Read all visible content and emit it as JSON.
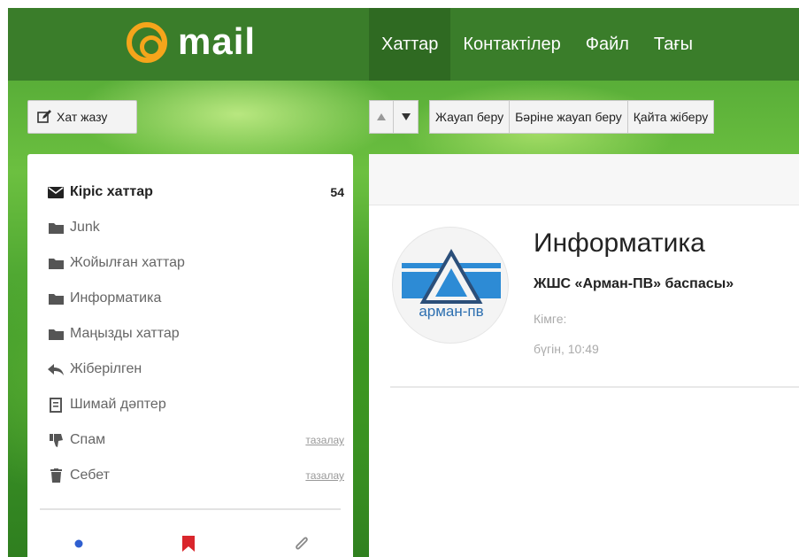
{
  "logo": {
    "text": "mail",
    "at_color": "#f5a51b"
  },
  "topnav": [
    {
      "label": "Хаттар",
      "active": true
    },
    {
      "label": "Контактілер",
      "active": false
    },
    {
      "label": "Файл",
      "active": false
    },
    {
      "label": "Тағы",
      "active": false
    }
  ],
  "toolbar": {
    "compose_label": "Хат жазу",
    "compose_icon": "pencil-edit-icon",
    "prev_icon": "arrow-up-icon",
    "next_icon": "arrow-down-icon",
    "actions": [
      "Жауап беру",
      "Бәріне жауап беру",
      "Қайта жіберу"
    ]
  },
  "sidebar": {
    "folders": [
      {
        "label": "Кіріс хаттар",
        "icon": "envelope-icon",
        "count": "54",
        "active": true
      },
      {
        "label": "Junk",
        "icon": "folder-icon"
      },
      {
        "label": "Жойылған хаттар",
        "icon": "folder-icon"
      },
      {
        "label": "Информатика",
        "icon": "folder-icon"
      },
      {
        "label": "Маңызды хаттар",
        "icon": "folder-icon"
      },
      {
        "label": "Жіберілген",
        "icon": "reply-arrow-icon"
      },
      {
        "label": "Шимай дәптер",
        "icon": "draft-note-icon"
      },
      {
        "label": "Спам",
        "icon": "thumbs-down-icon",
        "action": "тазалау"
      },
      {
        "label": "Себет",
        "icon": "trash-icon",
        "action": "тазалау"
      }
    ],
    "bottom_icons": [
      "unread-dot-icon",
      "flag-bookmark-icon",
      "attachment-clip-icon"
    ]
  },
  "message": {
    "subject": "Информатика",
    "sender": "ЖШС «Арман-ПВ» баспасы»",
    "to_label": "Кімге:",
    "date": "бүгін, 10:49",
    "avatar_text": "арман-пв"
  },
  "colors": {
    "topbar": "#3a7d2a",
    "nav_active": "#2f6a22",
    "logo_orange": "#f5a51b",
    "flag_red": "#d9262c",
    "dot_blue": "#2f5fd0",
    "avatar_blue": "#2d8bd5"
  }
}
